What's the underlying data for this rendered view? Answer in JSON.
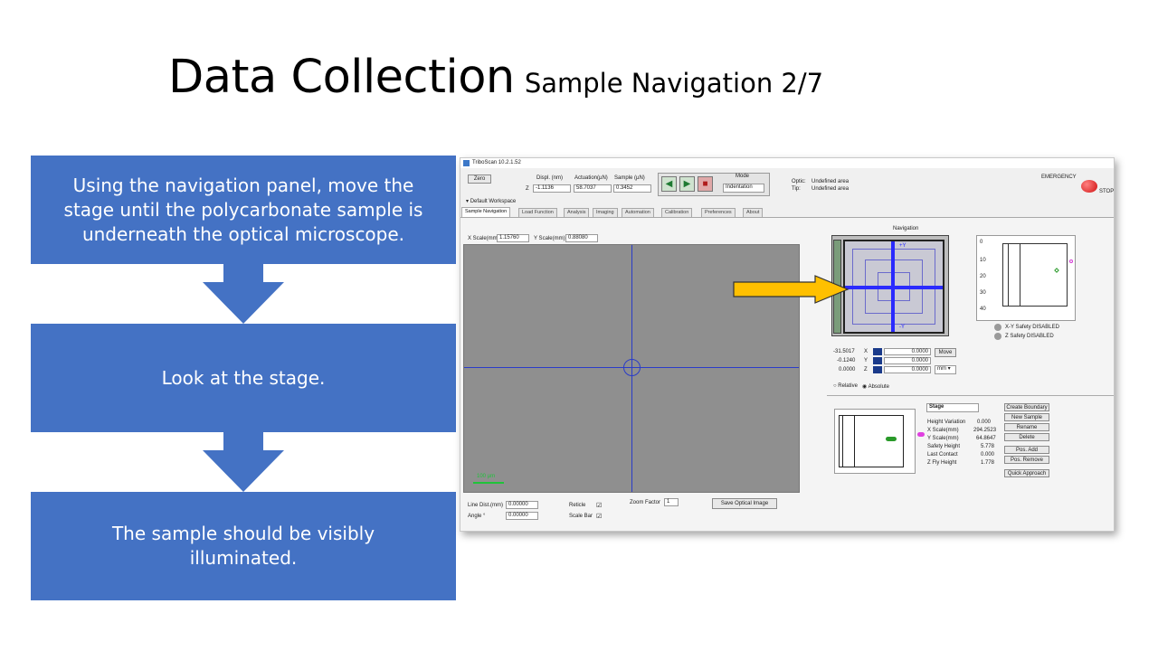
{
  "slide": {
    "title": "Data Collection",
    "subtitle": "Sample Navigation 2/7",
    "steps": [
      "Using the navigation panel, move the stage until the polycarbonate sample is underneath the optical microscope.",
      "Look at the stage.",
      "The sample should be visibly illuminated."
    ]
  },
  "app": {
    "window_title": "TriboScan 10.2.1.52",
    "zero_label": "Zero",
    "z_label": "Z",
    "readouts": [
      {
        "header": "Displ. (nm)",
        "value": "-1.1136"
      },
      {
        "header": "Actuation(µN)",
        "value": "58.7037"
      },
      {
        "header": "Sample (µN)",
        "value": "0.3452"
      }
    ],
    "mode_label": "Mode",
    "mode_value": "Indentation",
    "optic_label": "Optic:",
    "optic_value": "Undefined area",
    "tip_label": "Tip:",
    "tip_value": "Undefined area",
    "emergency_label": "EMERGENCY",
    "stop_label": "STOP",
    "workspace": "Default Workspace",
    "tabs": [
      "Sample Navigation",
      "Load Function",
      "Analysis",
      "Imaging",
      "Automation",
      "Calibration",
      "Preferences",
      "About"
    ],
    "x_scale_label": "X Scale(mm)",
    "x_scale_value": "1.15760",
    "y_scale_label": "Y Scale(mm)",
    "y_scale_value": "0.88080",
    "scalebar_label": "100 µm",
    "line_dist_label": "Line Dist.(mm)",
    "line_dist_value": "0.00000",
    "angle_label": "Angle °",
    "angle_value": "0.00000",
    "reticle_label": "Reticle",
    "scale_bar_label": "Scale Bar",
    "zoom_label": "Zoom Factor",
    "zoom_value": "1",
    "save_optical_label": "Save Optical Image",
    "navigation_label": "Navigation",
    "nav_plus_y": "+Y",
    "nav_minus_y": "-Y",
    "plot_ticks": [
      "0",
      "10",
      "20",
      "30",
      "40"
    ],
    "xy_safety": "X-Y Safety DISABLED",
    "z_safety": "Z Safety DISABLED",
    "coords": [
      {
        "current": "-31.5017",
        "axis": "X",
        "target": "0.0000"
      },
      {
        "current": "-0.1240",
        "axis": "Y",
        "target": "0.0000"
      },
      {
        "current": "0.0000",
        "axis": "Z",
        "target": "0.0000"
      }
    ],
    "move_label": "Move",
    "unit_value": "mm",
    "relative_label": "Relative",
    "absolute_label": "Absolute",
    "stage_label": "Stage",
    "stage_fields": [
      {
        "name": "Height Variation",
        "value": "0.000"
      },
      {
        "name": "X Scale(mm)",
        "value": "294.2523"
      },
      {
        "name": "Y Scale(mm)",
        "value": "64.8647"
      },
      {
        "name": "Safety Height",
        "value": "5.778"
      },
      {
        "name": "Last Contact",
        "value": "0.000"
      },
      {
        "name": "Z Fly Height",
        "value": "1.778"
      }
    ],
    "stage_buttons": [
      "Create Boundary",
      "New Sample",
      "Rename",
      "Delete",
      "Pos. Add",
      "Pos. Remove",
      "Quick Approach"
    ]
  },
  "colors": {
    "box_blue": "#4472c4",
    "callout_fill": "#ffc000",
    "reticle_blue": "#2a3cc8"
  }
}
